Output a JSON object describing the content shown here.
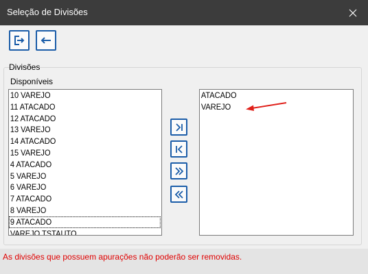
{
  "window": {
    "title": "Seleção de Divisões"
  },
  "toolbar": {
    "buttons": [
      {
        "icon": "exit-icon"
      },
      {
        "icon": "back-arrow-icon"
      }
    ]
  },
  "group": {
    "title": "Divisões"
  },
  "available": {
    "label": "Disponíveis",
    "items": [
      "10 VAREJO",
      "11 ATACADO",
      "12 ATACADO",
      "13 VAREJO",
      "14 ATACADO",
      "15 VAREJO",
      "4 ATACADO",
      "5 VAREJO",
      "6 VAREJO",
      "7 ATACADO",
      "8 VAREJO",
      "9 ATACADO",
      "VAREJO TSTAUTO"
    ]
  },
  "selected": {
    "items": [
      "ATACADO",
      "VAREJO"
    ]
  },
  "move_buttons": [
    {
      "icon": "move-right-icon",
      "glyph": "›|"
    },
    {
      "icon": "move-left-icon",
      "glyph": "|‹"
    },
    {
      "icon": "move-all-right-icon",
      "glyph": "»"
    },
    {
      "icon": "move-all-left-icon",
      "glyph": "«"
    }
  ],
  "footer": {
    "message": "As divisões que possuem apurações não poderão ser removidas."
  },
  "colors": {
    "titlebar": "#3c3c3c",
    "button_border": "#1a5ca8",
    "footer_text": "#e00000",
    "annotation_arrow": "#e0201a"
  }
}
